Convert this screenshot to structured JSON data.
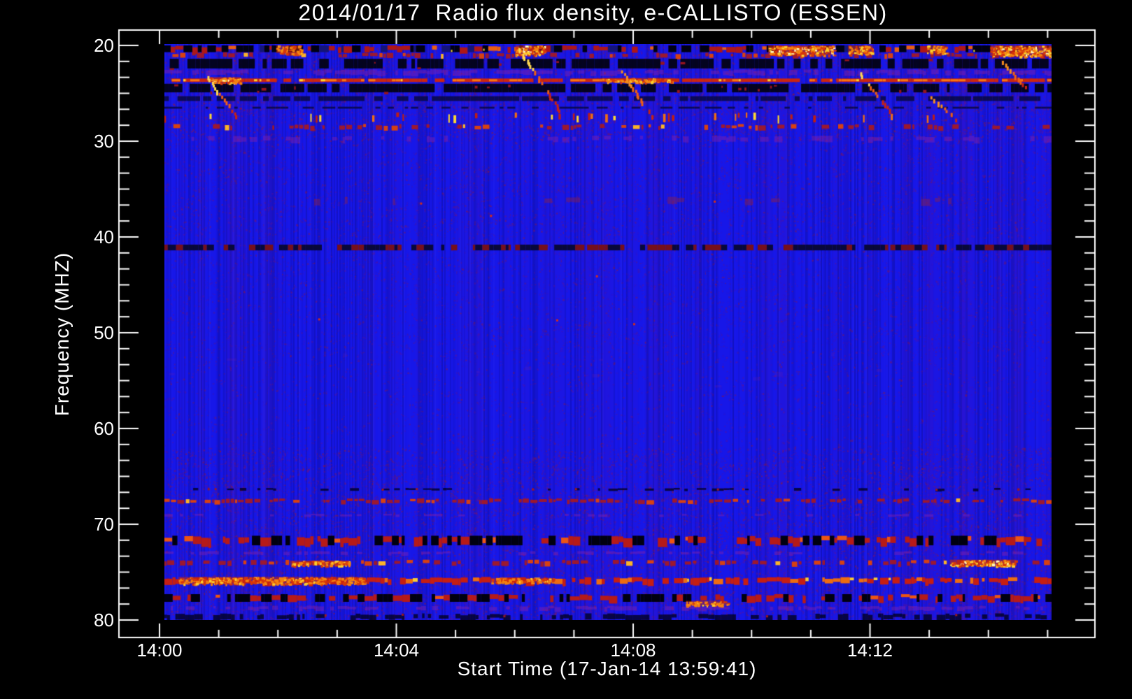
{
  "title": "2014/01/17  Radio flux density, e-CALLISTO (ESSEN)",
  "colors": {
    "page_background": "#000000",
    "frame": "#ffffff",
    "text": "#ffffff",
    "base_blue": "#1717e8",
    "speckle_purple": "#6e1287",
    "speckle_red": "#961928",
    "hot_red": "#d42712",
    "hot_orange": "#f5820f",
    "hot_yellow": "#fcd732",
    "hot_white": "#fffabe",
    "band_black": "#000012",
    "band_navy": "#08083e"
  },
  "chart_data": {
    "type": "heatmap",
    "title": "2014/01/17  Radio flux density, e-CALLISTO (ESSEN)",
    "xlabel": "Start Time (17-Jan-14 13:59:41)",
    "ylabel": "Frequency (MHZ)",
    "x_axis": {
      "tick_labels": [
        "14:00",
        "14:04",
        "14:08",
        "14:12"
      ],
      "tick_minutes": [
        0,
        4,
        8,
        12
      ],
      "minor_step_minutes": 1,
      "minor_last_minute": 15,
      "data_start_minute": 0.08,
      "data_end_minute": 15.07
    },
    "y_axis": {
      "unit": "MHZ",
      "min": 20,
      "max": 80,
      "major_ticks": [
        20,
        30,
        40,
        50,
        60,
        70,
        80
      ],
      "minor_divisions_per_major": 6,
      "orientation": "increasing downward"
    },
    "legend": "none",
    "grid": "off",
    "features": {
      "note": "RFI bands: f in MHz, times in minutes after 14:00",
      "bands": [
        {
          "f0": 20.0,
          "f1": 20.7,
          "style": "burst",
          "density": 0.9
        },
        {
          "f0": 20.7,
          "f1": 21.4,
          "style": "redspeck",
          "density": 0.5
        },
        {
          "f0": 21.4,
          "f1": 22.4,
          "style": "dark",
          "density": 0.72,
          "redbits": true
        },
        {
          "f0": 22.5,
          "f1": 23.1,
          "style": "purple",
          "density": 0.55
        },
        {
          "f0": 23.4,
          "f1": 23.8,
          "style": "redline",
          "density": 0.88
        },
        {
          "f0": 24.0,
          "f1": 24.9,
          "style": "dark",
          "density": 0.78,
          "redbits": true
        },
        {
          "f0": 25.3,
          "f1": 25.8,
          "style": "navy",
          "density": 0.7
        },
        {
          "f0": 26.4,
          "f1": 26.6,
          "style": "navy",
          "density": 0.5
        },
        {
          "f0": 27.0,
          "f1": 27.9,
          "style": "burst2",
          "density": 0.22
        },
        {
          "f0": 28.2,
          "f1": 28.9,
          "style": "redspeck",
          "density": 0.4
        },
        {
          "f0": 29.4,
          "f1": 30.1,
          "style": "purple",
          "density": 0.35
        },
        {
          "f0": 35.8,
          "f1": 36.6,
          "style": "faintred",
          "density": 0.1
        },
        {
          "f0": 40.8,
          "f1": 41.4,
          "style": "mix",
          "density": 0.85
        },
        {
          "f0": 52.0,
          "f1": 56.0,
          "style": "faintpurple",
          "density": 0.08
        },
        {
          "f0": 66.2,
          "f1": 66.5,
          "style": "darkspeck",
          "density": 0.3
        },
        {
          "f0": 67.3,
          "f1": 67.9,
          "style": "redspeck",
          "density": 0.6
        },
        {
          "f0": 68.9,
          "f1": 69.2,
          "style": "purple",
          "density": 0.2
        },
        {
          "f0": 71.2,
          "f1": 72.2,
          "style": "mix2",
          "density": 0.8
        },
        {
          "f0": 72.8,
          "f1": 73.2,
          "style": "purple",
          "density": 0.4
        },
        {
          "f0": 73.7,
          "f1": 74.4,
          "style": "redspeck",
          "density": 0.5
        },
        {
          "f0": 75.5,
          "f1": 76.3,
          "style": "redstrong",
          "density": 0.7
        },
        {
          "f0": 77.3,
          "f1": 78.1,
          "style": "mix2",
          "density": 0.55
        },
        {
          "f0": 78.5,
          "f1": 79.0,
          "style": "purple",
          "density": 0.45
        },
        {
          "f0": 79.3,
          "f1": 80.0,
          "style": "darkspeck",
          "density": 0.6
        }
      ],
      "patches": [
        {
          "t0": 1.97,
          "t1": 2.39,
          "f0": 20.0,
          "f1": 20.8,
          "heat": 0.7
        },
        {
          "t0": 6.01,
          "t1": 6.5,
          "f0": 20.0,
          "f1": 21.0,
          "heat": 0.95
        },
        {
          "t0": 10.28,
          "t1": 11.39,
          "f0": 20.0,
          "f1": 21.0,
          "heat": 1.0
        },
        {
          "t0": 11.63,
          "t1": 12.04,
          "f0": 20.0,
          "f1": 20.9,
          "heat": 0.85
        },
        {
          "t0": 12.96,
          "t1": 13.28,
          "f0": 20.0,
          "f1": 20.8,
          "heat": 0.8
        },
        {
          "t0": 14.03,
          "t1": 15.06,
          "f0": 20.0,
          "f1": 21.1,
          "heat": 1.0
        },
        {
          "t0": 0.85,
          "t1": 1.38,
          "f0": 23.3,
          "f1": 23.9,
          "heat": 1.0
        },
        {
          "t0": 7.47,
          "t1": 8.71,
          "f0": 23.4,
          "f1": 23.8,
          "heat": 0.8
        },
        {
          "t0": 2.21,
          "t1": 3.21,
          "f0": 73.8,
          "f1": 74.3,
          "heat": 0.75
        },
        {
          "t0": 13.35,
          "t1": 14.46,
          "f0": 73.7,
          "f1": 74.3,
          "heat": 0.95
        },
        {
          "t0": 0.32,
          "t1": 3.45,
          "f0": 75.5,
          "f1": 76.2,
          "heat": 0.65
        },
        {
          "t0": 8.89,
          "t1": 9.6,
          "f0": 78.0,
          "f1": 78.5,
          "heat": 0.5
        },
        {
          "t0": 5.58,
          "t1": 6.64,
          "f0": 75.6,
          "f1": 76.1,
          "heat": 0.5
        }
      ],
      "diagonals": [
        {
          "t0": 0.8,
          "f0": 23.2,
          "t1": 1.3,
          "f1": 27.4,
          "heat": 0.9
        },
        {
          "t0": 6.07,
          "f0": 20.3,
          "t1": 6.76,
          "f1": 26.8,
          "heat": 0.85
        },
        {
          "t0": 7.8,
          "f0": 22.6,
          "t1": 8.32,
          "f1": 27.4,
          "heat": 0.6
        },
        {
          "t0": 11.82,
          "f0": 22.8,
          "t1": 12.31,
          "f1": 26.6,
          "heat": 0.9
        },
        {
          "t0": 13.02,
          "f0": 25.3,
          "t1": 13.52,
          "f1": 28.0,
          "heat": 0.55
        },
        {
          "t0": 14.23,
          "f0": 21.6,
          "t1": 14.68,
          "f1": 24.6,
          "heat": 0.5
        }
      ],
      "dots": [
        {
          "t": 5.58,
          "f": 37.7
        },
        {
          "t": 7.37,
          "f": 44.0
        },
        {
          "t": 2.68,
          "f": 48.5
        },
        {
          "t": 8.0,
          "f": 49.0
        },
        {
          "t": 6.7,
          "f": 48.6
        },
        {
          "t": 9.36,
          "f": 36.2
        },
        {
          "t": 4.4,
          "f": 36.4
        }
      ]
    }
  }
}
